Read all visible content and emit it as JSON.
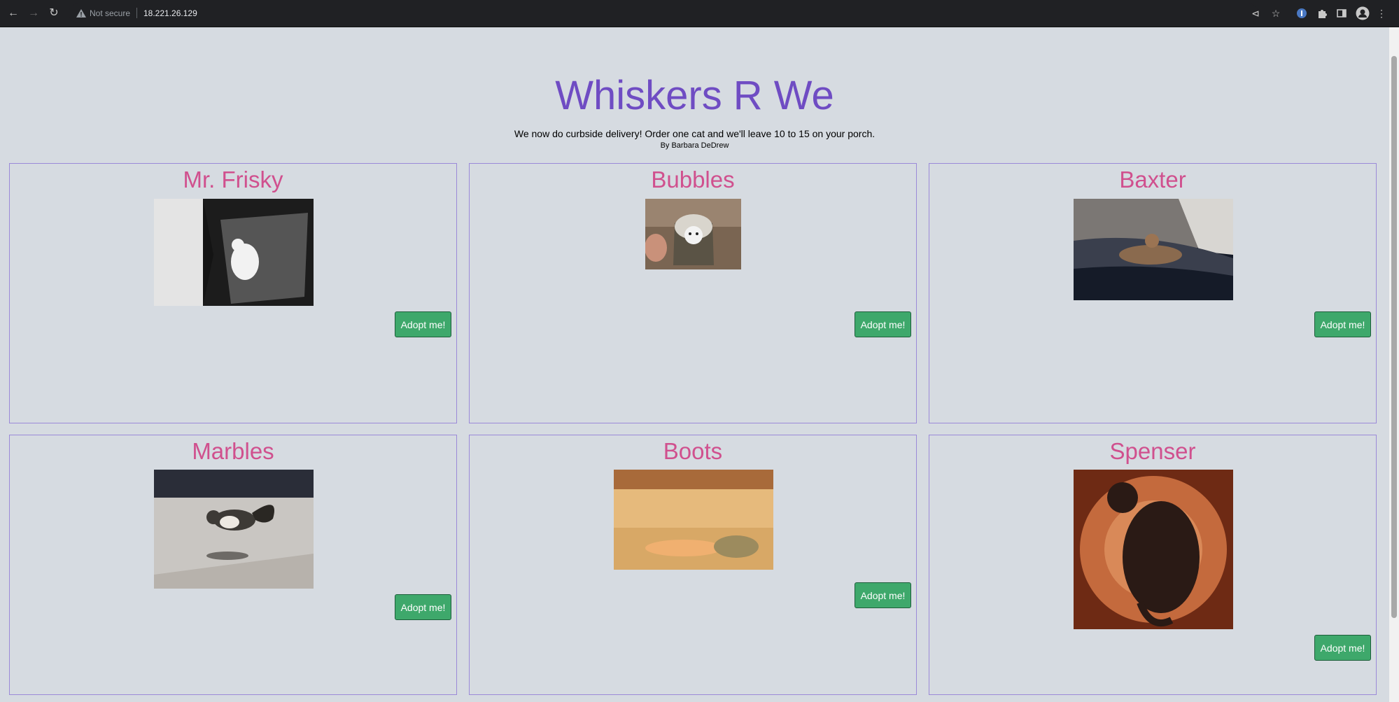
{
  "browser": {
    "security_label": "Not secure",
    "url": "18.221.26.129"
  },
  "site": {
    "title": "Whiskers R We",
    "tagline": "We now do curbside delivery! Order one cat and we'll leave 10 to 15 on your porch.",
    "byline": "By Barbara DeDrew"
  },
  "cats": [
    {
      "name": "Mr. Frisky",
      "button": "Adopt me!"
    },
    {
      "name": "Bubbles",
      "button": "Adopt me!"
    },
    {
      "name": "Baxter",
      "button": "Adopt me!"
    },
    {
      "name": "Marbles",
      "button": "Adopt me!"
    },
    {
      "name": "Boots",
      "button": "Adopt me!"
    },
    {
      "name": "Spenser",
      "button": "Adopt me!"
    }
  ],
  "colors": {
    "page_bg": "#d6dbe1",
    "title": "#6f4cc3",
    "cat_name": "#d0508e",
    "card_border": "#9b8ad8",
    "button_bg": "#3ea86b"
  }
}
